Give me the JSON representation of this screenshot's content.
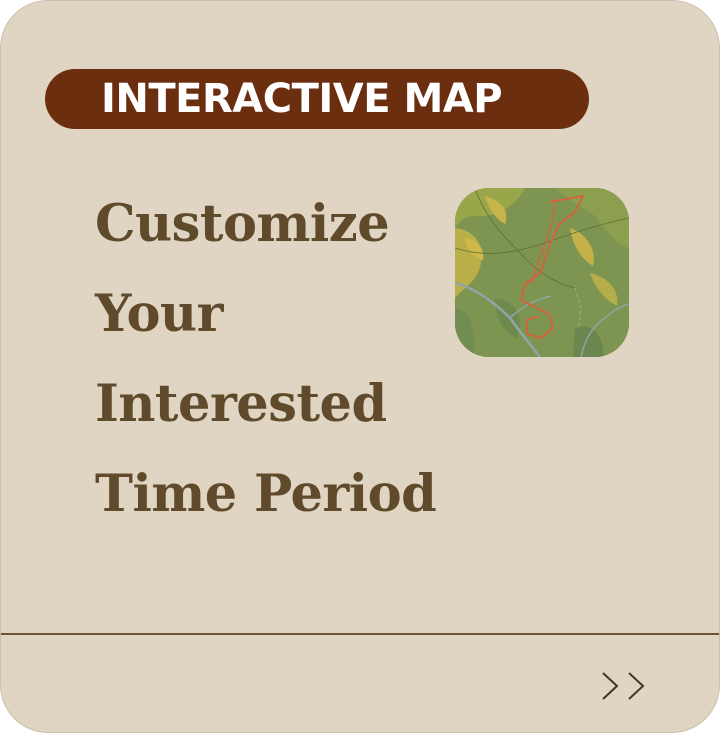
{
  "card": {
    "badge_label": "INTERACTIVE MAP",
    "headline_lines": [
      "Customize",
      "Your",
      "Interested",
      "Time Period"
    ],
    "thumbnail_icon": "map-thumbnail-icon",
    "next_icon": "double-chevron-right-icon"
  },
  "colors": {
    "card_background": "#e0d5c3",
    "badge_background": "#6b2f10",
    "badge_text": "#ffffff",
    "headline_text": "#5f4b2b",
    "divider": "#6b5534",
    "map_route": "#d9603a"
  }
}
